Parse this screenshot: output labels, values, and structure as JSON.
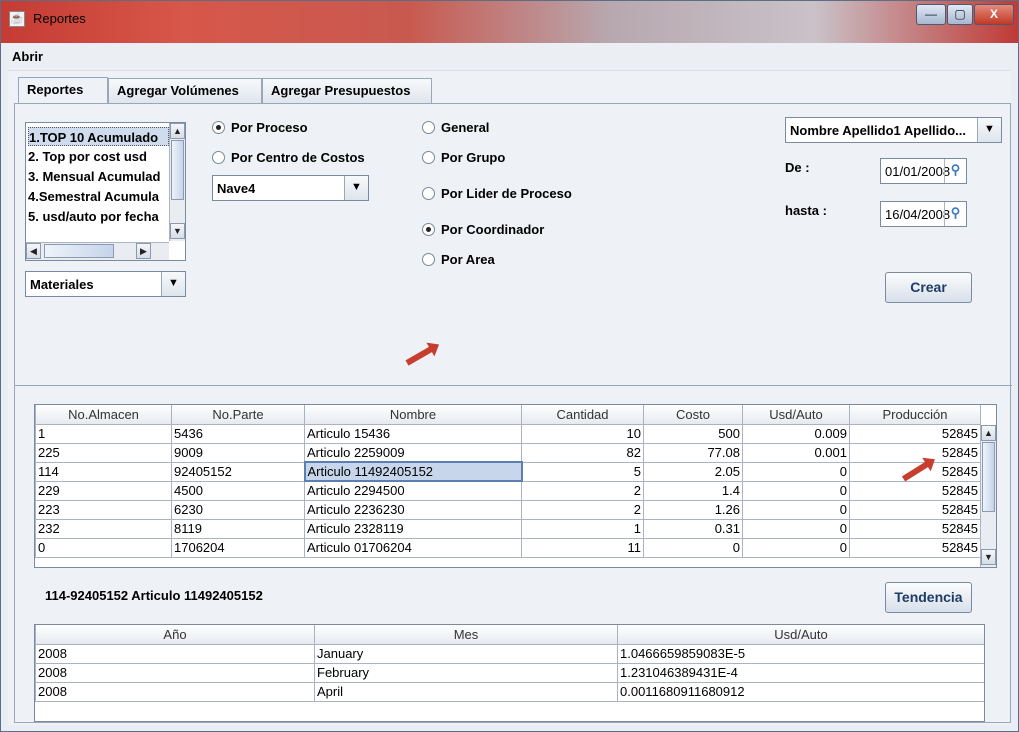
{
  "window": {
    "title": "Reportes",
    "minimize_glyph": "—",
    "maximize_glyph": "▢",
    "close_glyph": "X"
  },
  "menu": {
    "abrir": "Abrir"
  },
  "tabs": [
    "Reportes",
    "Agregar Volúmenes",
    "Agregar Presupuestos"
  ],
  "reports_list": [
    "1.TOP 10 Acumulado",
    "2. Top por cost usd",
    "3. Mensual Acumulad",
    "4.Semestral Acumula",
    "5. usd/auto por fecha"
  ],
  "materiales": "Materiales",
  "radios_left": {
    "por_proceso": "Por Proceso",
    "por_centro": "Por Centro de Costos"
  },
  "nave": "Nave4",
  "radios_mid": {
    "general": "General",
    "por_grupo": "Por Grupo",
    "por_lider": "Por Lider de Proceso",
    "por_coordinador": "Por Coordinador",
    "por_area": "Por Area"
  },
  "person_combo": "Nombre Apellido1 Apellido...",
  "de_label": "De :",
  "de_value": "01/01/2008",
  "hasta_label": "hasta :",
  "hasta_value": "16/04/2008",
  "crear": "Crear",
  "main_table": {
    "columns": [
      "No.Almacen",
      "No.Parte",
      "Nombre",
      "Cantidad",
      "Costo",
      "Usd/Auto",
      "Producción"
    ],
    "rows": [
      [
        "1",
        "5436",
        "Articulo 15436",
        "10",
        "500",
        "0.009",
        "52845"
      ],
      [
        "225",
        "9009",
        "Articulo 2259009",
        "82",
        "77.08",
        "0.001",
        "52845"
      ],
      [
        "114",
        "92405152",
        "Articulo 11492405152",
        "5",
        "2.05",
        "0",
        "52845"
      ],
      [
        "229",
        "4500",
        "Articulo 2294500",
        "2",
        "1.4",
        "0",
        "52845"
      ],
      [
        "223",
        "6230",
        "Articulo 2236230",
        "2",
        "1.26",
        "0",
        "52845"
      ],
      [
        "232",
        "8119",
        "Articulo 2328119",
        "1",
        "0.31",
        "0",
        "52845"
      ],
      [
        "0",
        "1706204",
        "Articulo 01706204",
        "11",
        "0",
        "0",
        "52845"
      ]
    ]
  },
  "selected_label": "114-92405152 Articulo 11492405152",
  "tendencia": "Tendencia",
  "trend_table": {
    "columns": [
      "Año",
      "Mes",
      "Usd/Auto"
    ],
    "rows": [
      [
        "2008",
        "January",
        "1.0466659859083E-5"
      ],
      [
        "2008",
        "February",
        "1.231046389431E-4"
      ],
      [
        "2008",
        "April",
        "0.0011680911680912"
      ]
    ]
  },
  "icons": {
    "app": "java-cup-icon",
    "calendar": "calendar-pin-icon",
    "annotation": "red-arrow-icon"
  },
  "colors": {
    "title_bar": "#c53b33",
    "selection": "#c7d6ea",
    "arrow": "#c73d2e"
  }
}
